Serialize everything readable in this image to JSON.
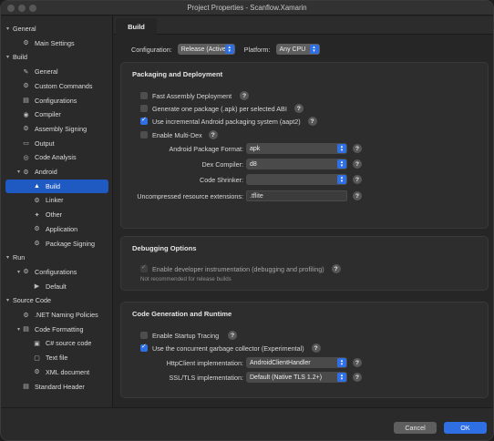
{
  "window": {
    "title": "Project Properties - Scanflow.Xamarin"
  },
  "sidebar": {
    "items": [
      {
        "label": "General",
        "icon": "",
        "chevron": "▾",
        "level": 0
      },
      {
        "label": "Main Settings",
        "icon": "⚙",
        "chevron": "",
        "level": 1
      },
      {
        "label": "Build",
        "icon": "",
        "chevron": "▾",
        "level": 0
      },
      {
        "label": "General",
        "icon": "✎",
        "chevron": "",
        "level": 1
      },
      {
        "label": "Custom Commands",
        "icon": "⚙",
        "chevron": "",
        "level": 1
      },
      {
        "label": "Configurations",
        "icon": "▤",
        "chevron": "",
        "level": 1
      },
      {
        "label": "Compiler",
        "icon": "◉",
        "chevron": "",
        "level": 1
      },
      {
        "label": "Assembly Signing",
        "icon": "⚙",
        "chevron": "",
        "level": 1
      },
      {
        "label": "Output",
        "icon": "▭",
        "chevron": "",
        "level": 1
      },
      {
        "label": "Code Analysis",
        "icon": "◎",
        "chevron": "",
        "level": 1
      },
      {
        "label": "Android",
        "icon": "⚙",
        "chevron": "▾",
        "level": 1
      },
      {
        "label": "Build",
        "icon": "▲",
        "chevron": "",
        "level": 2,
        "selected": true
      },
      {
        "label": "Linker",
        "icon": "⚙",
        "chevron": "",
        "level": 2
      },
      {
        "label": "Other",
        "icon": "✦",
        "chevron": "",
        "level": 2
      },
      {
        "label": "Application",
        "icon": "⚙",
        "chevron": "",
        "level": 2
      },
      {
        "label": "Package Signing",
        "icon": "⚙",
        "chevron": "",
        "level": 2
      },
      {
        "label": "Run",
        "icon": "",
        "chevron": "▾",
        "level": 0
      },
      {
        "label": "Configurations",
        "icon": "⚙",
        "chevron": "▾",
        "level": 1
      },
      {
        "label": "Default",
        "icon": "▶",
        "chevron": "",
        "level": 2
      },
      {
        "label": "Source Code",
        "icon": "",
        "chevron": "▾",
        "level": 0
      },
      {
        "label": ".NET Naming Policies",
        "icon": "⚙",
        "chevron": "",
        "level": 1
      },
      {
        "label": "Code Formatting",
        "icon": "▤",
        "chevron": "▾",
        "level": 1
      },
      {
        "label": "C# source code",
        "icon": "▣",
        "chevron": "",
        "level": 2
      },
      {
        "label": "Text file",
        "icon": "▢",
        "chevron": "",
        "level": 2
      },
      {
        "label": "XML document",
        "icon": "⚙",
        "chevron": "",
        "level": 2
      },
      {
        "label": "Standard Header",
        "icon": "▤",
        "chevron": "",
        "level": 1
      }
    ]
  },
  "tabs": {
    "active": "Build"
  },
  "config": {
    "configuration_label": "Configuration:",
    "configuration_value": "Release (Active)",
    "platform_label": "Platform:",
    "platform_value": "Any CPU"
  },
  "packaging": {
    "title": "Packaging and Deployment",
    "fast_assembly": {
      "label": "Fast Assembly Deployment",
      "checked": false
    },
    "one_package_per_abi": {
      "label": "Generate one package (.apk) per selected ABI",
      "checked": false
    },
    "incremental": {
      "label": "Use incremental Android packaging system (aapt2)",
      "checked": true
    },
    "multidex": {
      "label": "Enable Multi-Dex",
      "checked": false
    },
    "package_format_label": "Android Package Format:",
    "package_format_value": "apk",
    "dex_compiler_label": "Dex Compiler:",
    "dex_compiler_value": "d8",
    "code_shrinker_label": "Code Shrinker:",
    "code_shrinker_value": "",
    "uncompressed_label": "Uncompressed resource extensions:",
    "uncompressed_value": ".tflite"
  },
  "debugging": {
    "title": "Debugging Options",
    "instrumentation": {
      "label": "Enable developer instrumentation (debugging and profiling)",
      "checked": true
    },
    "note": "Not recommended for release builds"
  },
  "codegen": {
    "title": "Code Generation and Runtime",
    "startup_tracing": {
      "label": "Enable Startup Tracing",
      "checked": false
    },
    "concurrent_gc": {
      "label": "Use the concurrent garbage collector (Experimental)",
      "checked": true
    },
    "httpclient_label": "HttpClient implementation:",
    "httpclient_value": "AndroidClientHandler",
    "ssl_label": "SSL/TLS implementation:",
    "ssl_value": "Default (Native TLS 1.2+)"
  },
  "footer": {
    "cancel": "Cancel",
    "ok": "OK"
  },
  "help_glyph": "?",
  "colors": {
    "accent": "#2f6fe4",
    "selection": "#1f59c2",
    "background": "#262626"
  }
}
